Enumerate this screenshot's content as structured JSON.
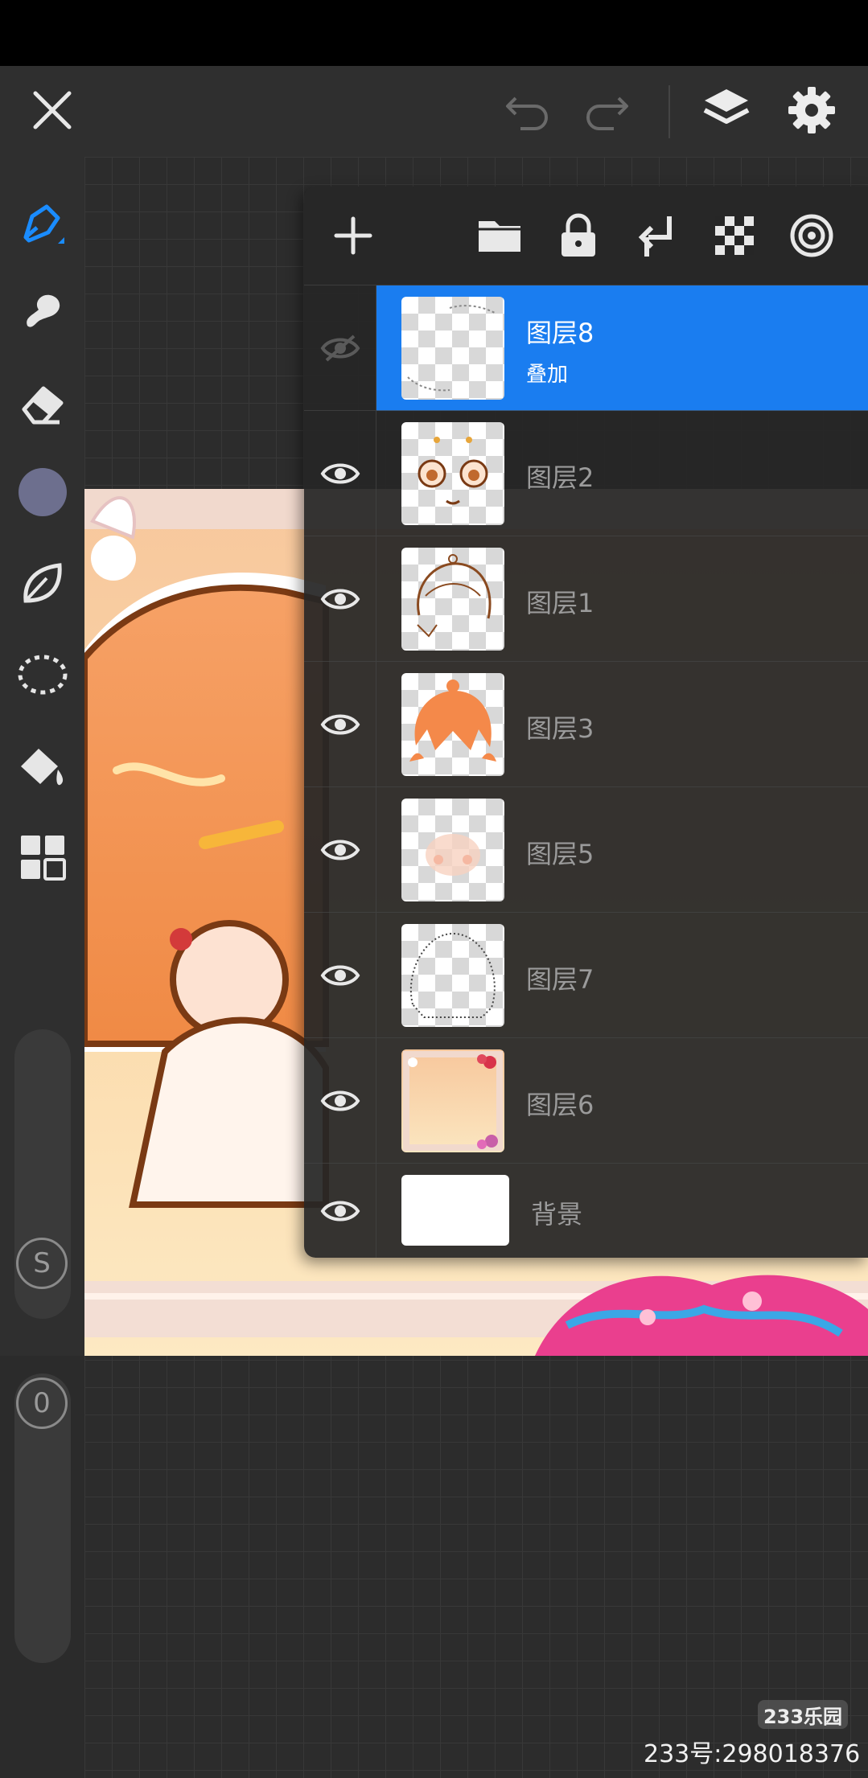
{
  "layers": [
    {
      "name": "图层8",
      "blend": "叠加",
      "selected": true,
      "visible": false
    },
    {
      "name": "图层2",
      "selected": false,
      "visible": true
    },
    {
      "name": "图层1",
      "selected": false,
      "visible": true
    },
    {
      "name": "图层3",
      "selected": false,
      "visible": true
    },
    {
      "name": "图层5",
      "selected": false,
      "visible": true
    },
    {
      "name": "图层7",
      "selected": false,
      "visible": true
    },
    {
      "name": "图层6",
      "selected": false,
      "visible": true
    },
    {
      "name": "背景",
      "selected": false,
      "visible": true
    }
  ],
  "toolbar": {
    "stabilizer_label": "S",
    "opacity_label": "0",
    "color_swatch": "#6d6f8e"
  },
  "colors": {
    "accent": "#1a7df0",
    "panel_bg": "#262626",
    "toolbar_bg": "#2f2f2f"
  },
  "icons": {
    "top": [
      "close-icon",
      "undo-icon",
      "redo-icon",
      "layers-icon",
      "settings-icon"
    ],
    "panel": [
      "add-icon",
      "folder-icon",
      "lock-icon",
      "merge-down-icon",
      "transparency-icon",
      "clipping-icon"
    ],
    "tools": [
      "pen-icon",
      "smudge-icon",
      "eraser-icon",
      "color-swatch",
      "leaf-brush-icon",
      "lasso-icon",
      "fill-icon",
      "grid-icon"
    ]
  },
  "watermark": {
    "logo": "233乐园",
    "text": "233号:298018376"
  }
}
